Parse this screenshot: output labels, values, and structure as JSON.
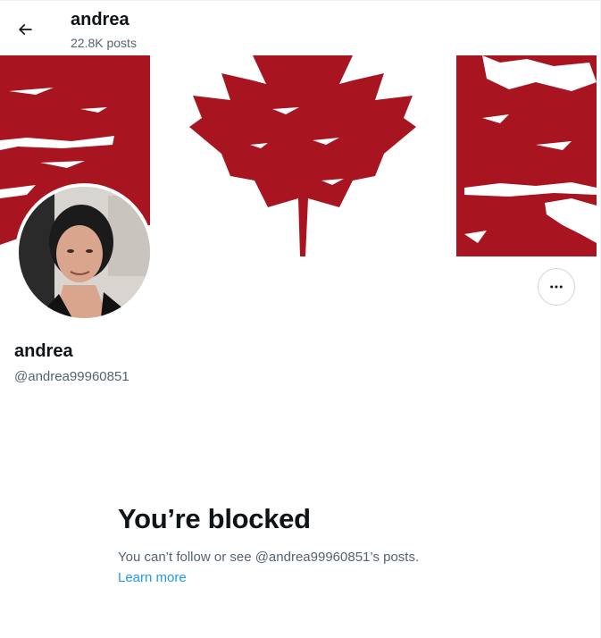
{
  "header": {
    "name": "andrea",
    "post_count": "22.8K posts",
    "back_icon": "arrow-left-icon"
  },
  "banner": {
    "description_icon": "canada-flag",
    "colors": {
      "red": "#a8141f",
      "white": "#ffffff"
    }
  },
  "profile": {
    "display_name": "andrea",
    "handle": "@andrea99960851",
    "more_icon": "ellipsis-icon"
  },
  "blocked": {
    "title": "You’re blocked",
    "message": "You can’t follow or see @andrea99960851’s posts.",
    "link": "Learn more"
  },
  "colors": {
    "text_primary": "#0f1419",
    "text_secondary": "#536471",
    "link": "#1d9bf0",
    "border": "#cfd9de"
  }
}
